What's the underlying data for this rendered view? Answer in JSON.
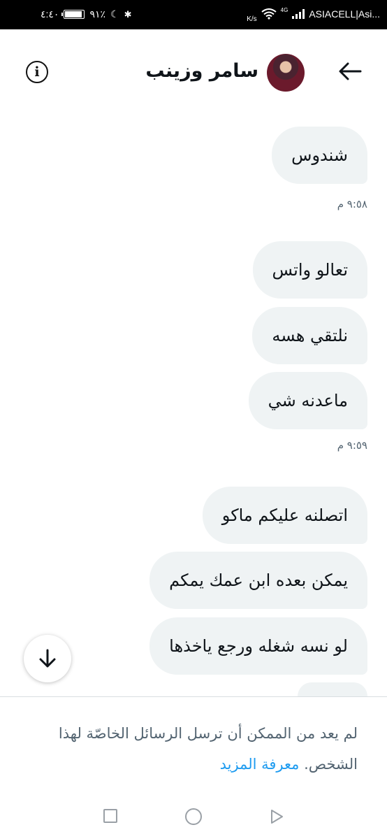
{
  "status_bar": {
    "time": "٤:٤٠",
    "battery": "٩١٪",
    "battery_level": 0.91,
    "network_type": "4G",
    "speed_unit": "K/s",
    "carrier": "ASIACELL|Asi..."
  },
  "header": {
    "title": "سامر وزينب",
    "info_icon": "info-icon",
    "back_icon": "arrow-back-icon"
  },
  "messages": [
    {
      "text": "شندوس"
    },
    {
      "text": "تعالو واتس"
    },
    {
      "text": "نلتقي هسه"
    },
    {
      "text": "ماعدنه شي"
    },
    {
      "text": "اتصلنه عليكم ماكو"
    },
    {
      "text": "يمكن بعده ابن عمك يمكم"
    },
    {
      "text": "لو نسه شغله ورجع ياخذها"
    }
  ],
  "timestamps": [
    "٩:٥٨ م",
    "٩:٥٩ م"
  ],
  "footer": {
    "notice": "لم يعد من الممكن أن ترسل الرسائل الخاصّة لهذا الشخص.",
    "learn_more": "معرفة المزيد"
  },
  "colors": {
    "bubble": "#eff3f4",
    "link": "#1d9bf0",
    "secondary_text": "#536471"
  }
}
